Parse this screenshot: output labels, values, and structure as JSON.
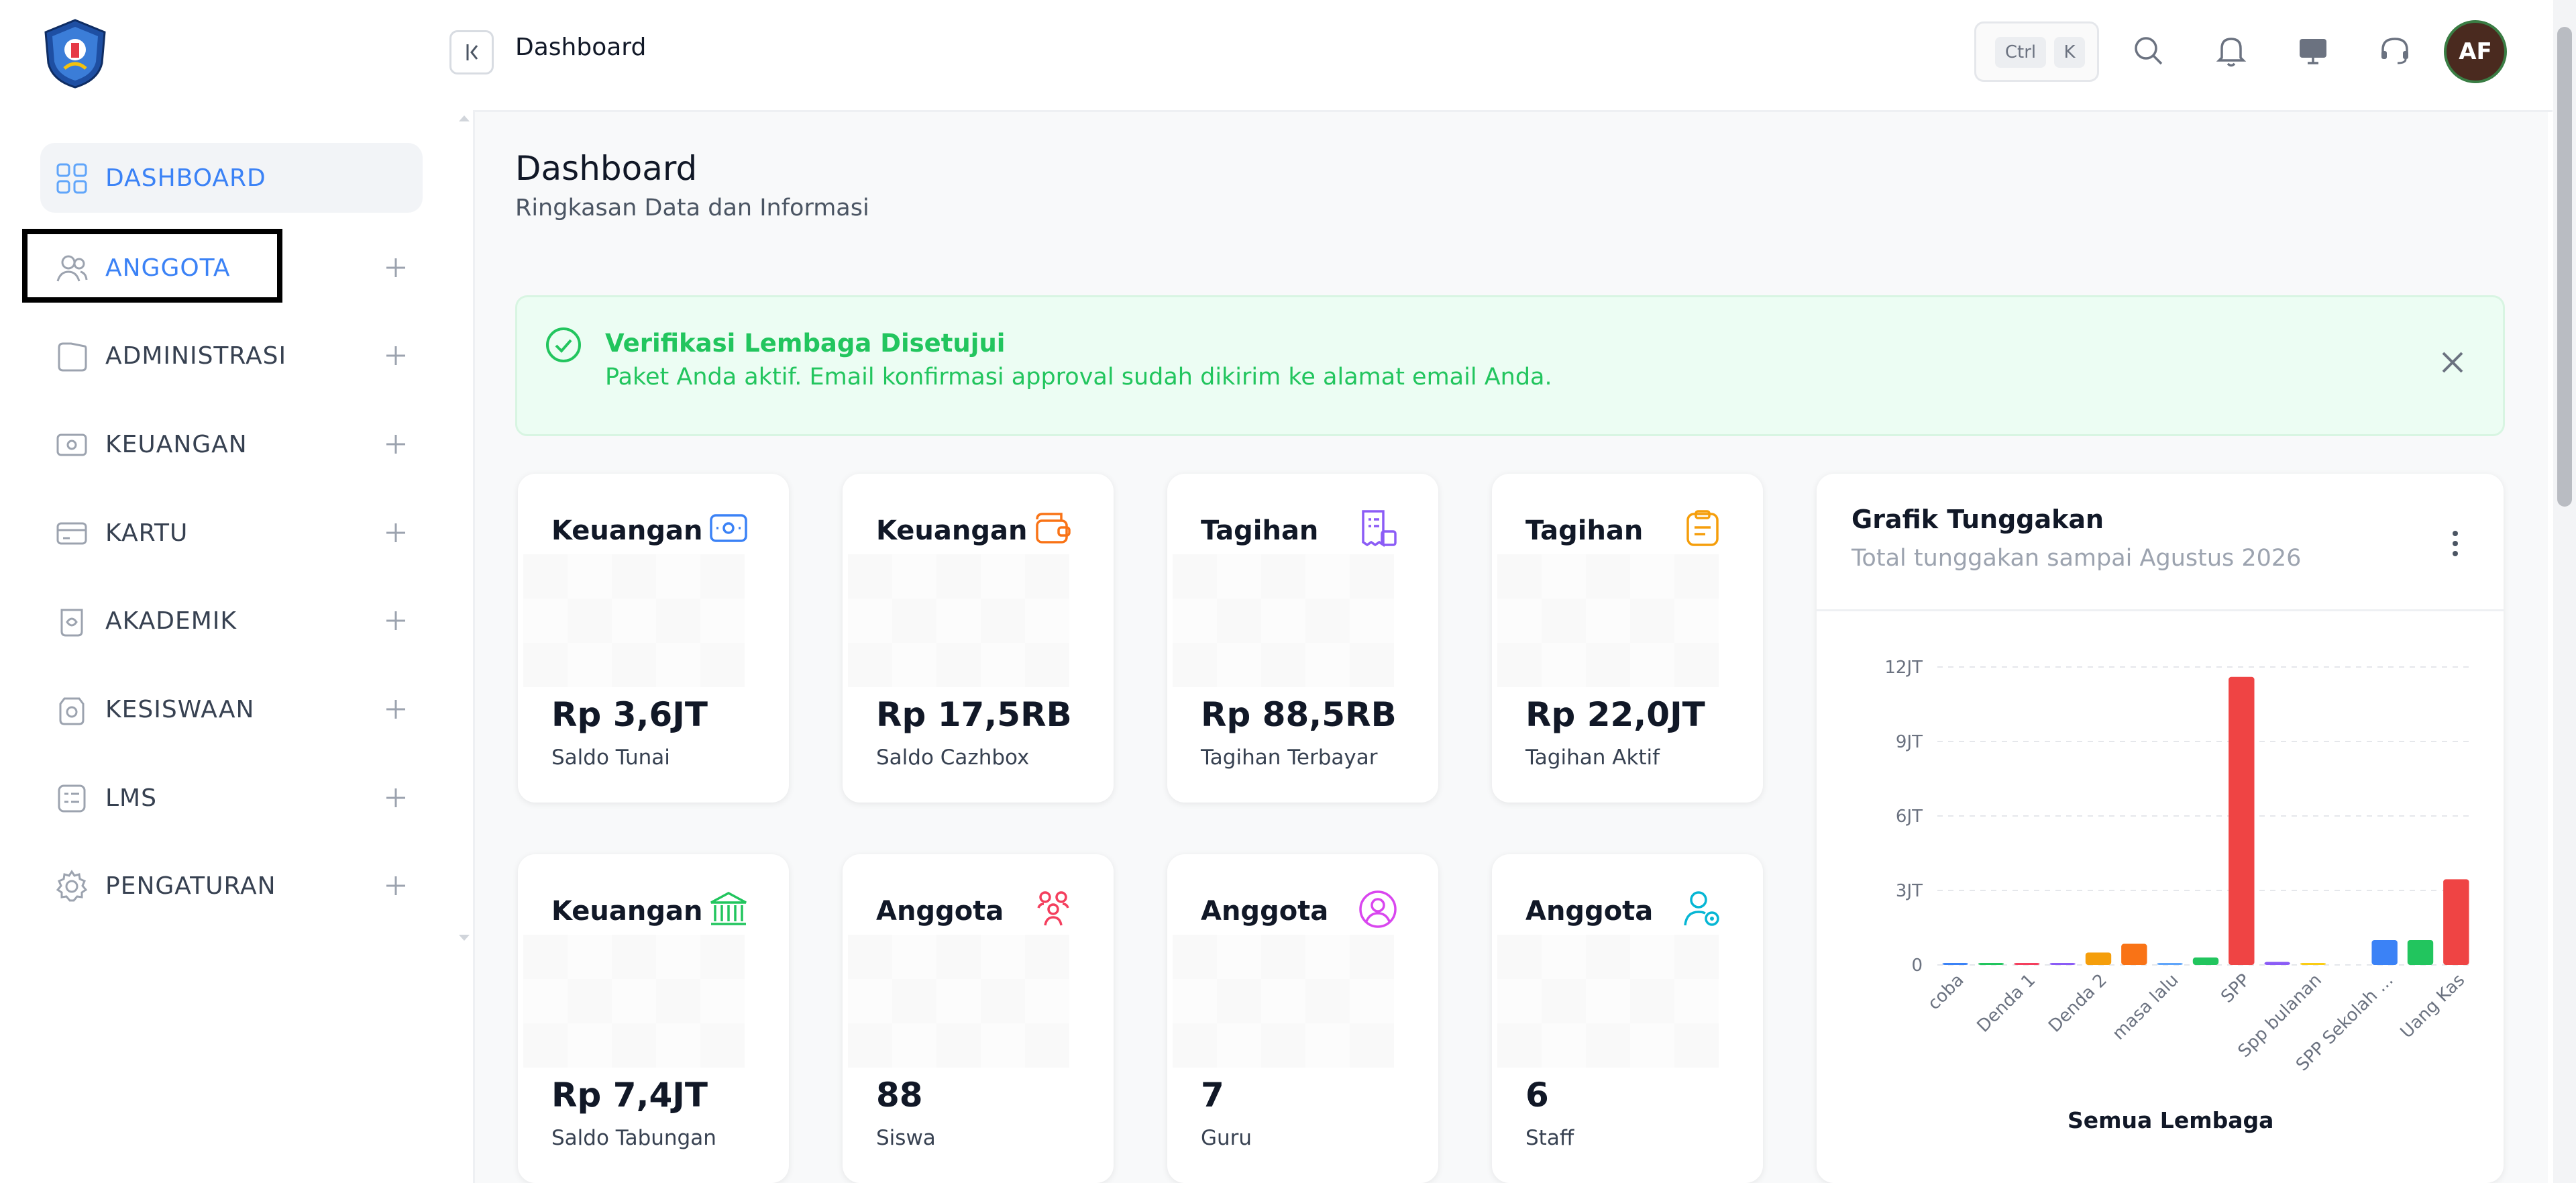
{
  "topbar": {
    "breadcrumb": "Dashboard",
    "kbd_ctrl": "Ctrl",
    "kbd_k": "K",
    "avatar_initials": "AF",
    "icons": [
      "collapse-sidebar-icon",
      "search-icon",
      "bell-icon",
      "monitor-icon",
      "headset-icon"
    ]
  },
  "sidebar": {
    "items": [
      {
        "label": "DASHBOARD",
        "icon": "grid-icon",
        "expandable": false,
        "active": true
      },
      {
        "label": "ANGGOTA",
        "icon": "users-icon",
        "expandable": true
      },
      {
        "label": "ADMINISTRASI",
        "icon": "folder-icon",
        "expandable": true
      },
      {
        "label": "KEUANGAN",
        "icon": "money-icon",
        "expandable": true
      },
      {
        "label": "KARTU",
        "icon": "card-icon",
        "expandable": true
      },
      {
        "label": "AKADEMIK",
        "icon": "academic-icon",
        "expandable": true
      },
      {
        "label": "KESISWAAN",
        "icon": "student-icon",
        "expandable": true
      },
      {
        "label": "LMS",
        "icon": "lms-icon",
        "expandable": true
      },
      {
        "label": "PENGATURAN",
        "icon": "gear-icon",
        "expandable": true
      }
    ]
  },
  "page": {
    "title": "Dashboard",
    "subtitle": "Ringkasan Data dan Informasi"
  },
  "alert": {
    "title": "Verifikasi Lembaga Disetujui",
    "text": "Paket Anda aktif. Email konfirmasi approval sudah dikirim ke alamat email Anda."
  },
  "cards": [
    {
      "title": "Keuangan",
      "value": "Rp 3,6JT",
      "label": "Saldo Tunai",
      "icon": "wallet-cash-icon",
      "color": "#3b82f6"
    },
    {
      "title": "Keuangan",
      "value": "Rp 17,5RB",
      "label": "Saldo Cazhbox",
      "icon": "wallet-icon",
      "color": "#f97316"
    },
    {
      "title": "Tagihan",
      "value": "Rp 88,5RB",
      "label": "Tagihan Terbayar",
      "icon": "invoice-paid-icon",
      "color": "#8b5cf6"
    },
    {
      "title": "Tagihan",
      "value": "Rp 22,0JT",
      "label": "Tagihan Aktif",
      "icon": "clipboard-icon",
      "color": "#f59e0b"
    },
    {
      "title": "Keuangan",
      "value": "Rp 7,4JT",
      "label": "Saldo Tabungan",
      "icon": "bank-icon",
      "color": "#22c55e"
    },
    {
      "title": "Anggota",
      "value": "88",
      "label": "Siswa",
      "icon": "group-icon",
      "color": "#f43f5e"
    },
    {
      "title": "Anggota",
      "value": "7",
      "label": "Guru",
      "icon": "user-circle-icon",
      "color": "#d946ef"
    },
    {
      "title": "Anggota",
      "value": "6",
      "label": "Staff",
      "icon": "user-settings-icon",
      "color": "#06b6d4"
    }
  ],
  "chart_card": {
    "title": "Grafik Tunggakan",
    "subtitle": "Total tunggakan sampai Agustus 2026",
    "footer": "Semua Lembaga"
  },
  "chart_data": {
    "type": "bar",
    "categories": [
      "coba",
      "",
      "Denda 1",
      "",
      "Denda 2",
      "",
      "masa lalu",
      "",
      "SPP",
      "",
      "Spp bulanan",
      "",
      "SPP Sekolah ...",
      "",
      "Uang Kas"
    ],
    "values": [
      0.05,
      0.05,
      0.08,
      0.08,
      0.5,
      0.85,
      0.05,
      0.3,
      11.6,
      0.12,
      0.08,
      0,
      1.0,
      1.0,
      3.45
    ],
    "colors": [
      "#3b82f6",
      "#22c55e",
      "#f43f5e",
      "#8b5cf6",
      "#f59e0b",
      "#f97316",
      "#60a5fa",
      "#22c55e",
      "#ef4444",
      "#8b5cf6",
      "#facc15",
      "#f97316",
      "#3b82f6",
      "#22c55e",
      "#ef4444"
    ],
    "extra_value": 3.45,
    "yticks": [
      "12JT",
      "9JT",
      "6JT",
      "3JT",
      "0"
    ],
    "ylim": [
      0,
      12
    ],
    "grid": true
  }
}
